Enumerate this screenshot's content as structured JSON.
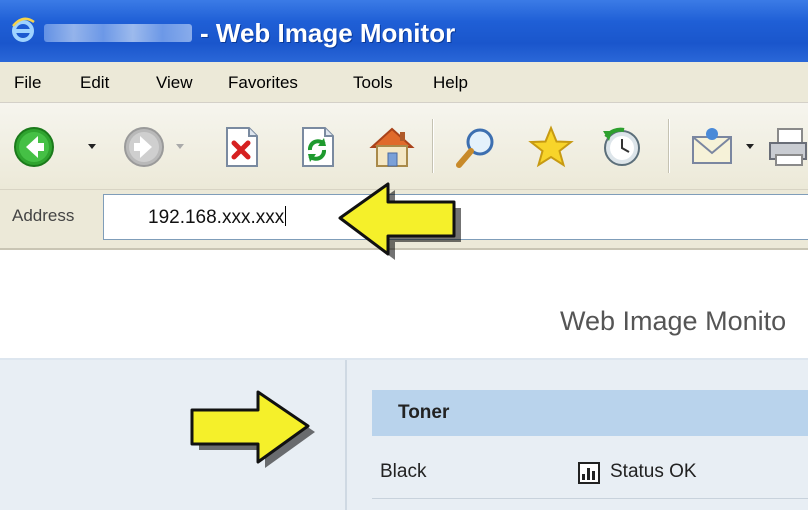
{
  "window": {
    "title": "- Web Image Monitor"
  },
  "menu": {
    "items": [
      "File",
      "Edit",
      "View",
      "Favorites",
      "Tools",
      "Help"
    ]
  },
  "toolbar": {
    "buttons": [
      "back-icon",
      "forward-icon",
      "stop-icon",
      "refresh-icon",
      "home-icon",
      "search-icon",
      "favorites-icon",
      "history-icon",
      "mail-icon",
      "print-icon"
    ]
  },
  "address": {
    "label": "Address",
    "value": "192.168.xxx.xxx"
  },
  "page": {
    "heading": "Web Image Monito",
    "toner": {
      "header": "Toner",
      "rows": [
        {
          "label": "Black",
          "status": "Status OK"
        }
      ]
    }
  },
  "colors": {
    "titlebar": "#1f5fd6",
    "arrow_fill": "#f5f02a",
    "toner_header": "#b9d3ec",
    "panel_bg": "#e8eef4"
  }
}
